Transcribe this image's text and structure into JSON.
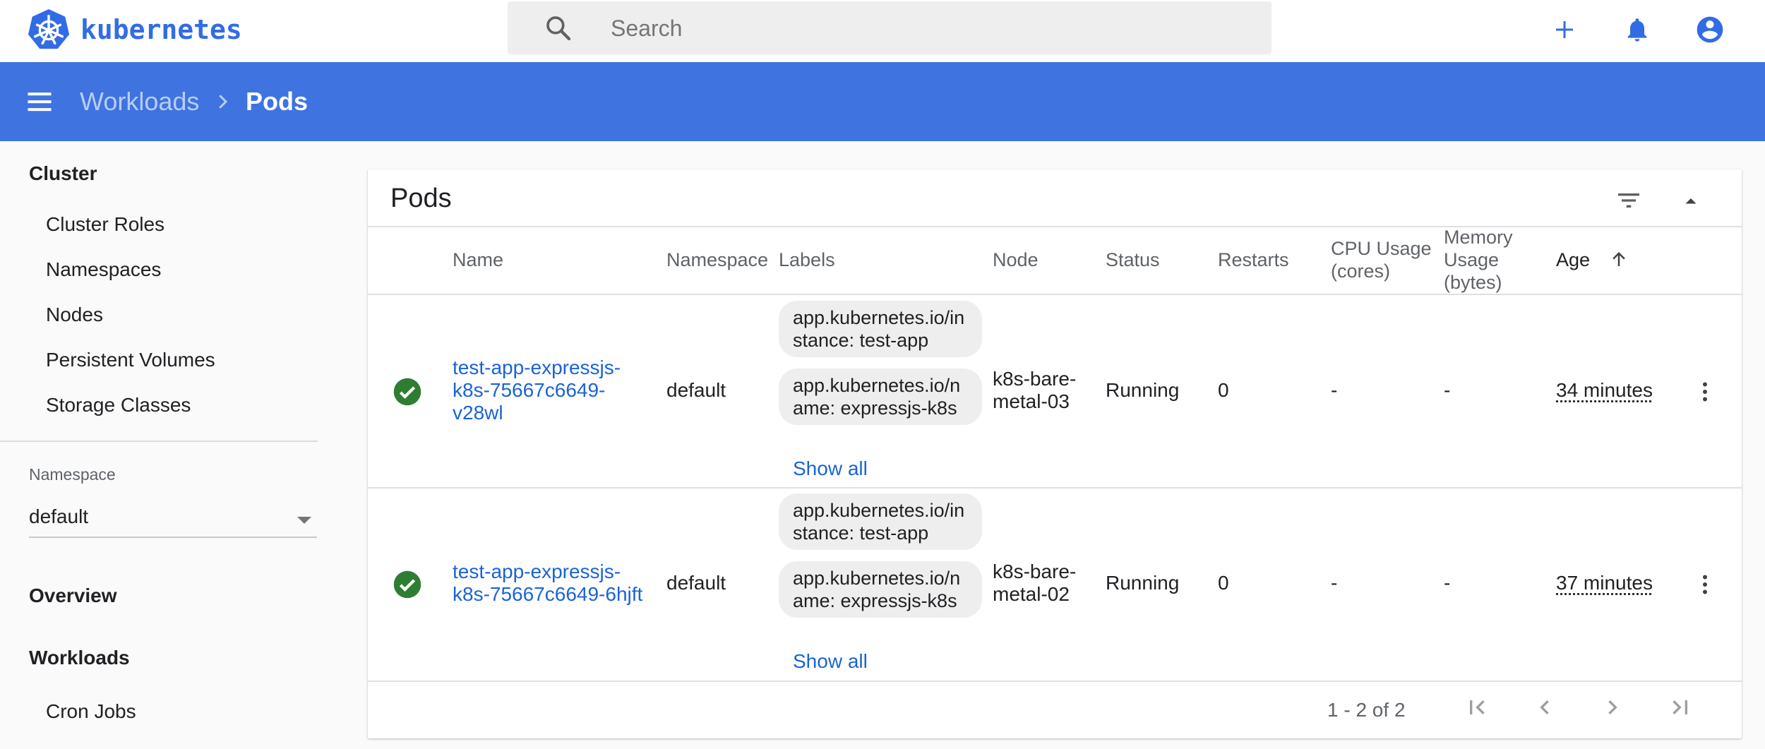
{
  "app": {
    "logo_text": "kubernetes"
  },
  "search": {
    "placeholder": "Search"
  },
  "breadcrumb": {
    "parent": "Workloads",
    "current": "Pods"
  },
  "sidebar": {
    "cluster_heading": "Cluster",
    "cluster_items": [
      {
        "label": "Cluster Roles"
      },
      {
        "label": "Namespaces"
      },
      {
        "label": "Nodes"
      },
      {
        "label": "Persistent Volumes"
      },
      {
        "label": "Storage Classes"
      }
    ],
    "namespace_label": "Namespace",
    "namespace_value": "default",
    "overview": "Overview",
    "workloads": "Workloads",
    "workload_items": [
      {
        "label": "Cron Jobs"
      }
    ]
  },
  "card": {
    "title": "Pods",
    "columns": {
      "name": "Name",
      "namespace": "Namespace",
      "labels": "Labels",
      "node": "Node",
      "status": "Status",
      "restarts": "Restarts",
      "cpu_1": "CPU Usage",
      "cpu_2": "(cores)",
      "mem_1": "Memory",
      "mem_2": "Usage",
      "mem_3": "(bytes)",
      "age": "Age"
    },
    "rows": [
      {
        "name_1": "test-app-expressjs-",
        "name_2": "k8s-75667c6649-",
        "name_3": "v28wl",
        "namespace": "default",
        "label_1": "app.kubernetes.io/instance: test-app",
        "label_2": "app.kubernetes.io/name: expressjs-k8s",
        "show_all": "Show all",
        "node_1": "k8s-bare-",
        "node_2": "metal-03",
        "status": "Running",
        "restarts": "0",
        "cpu": "-",
        "memory": "-",
        "age": "34 minutes"
      },
      {
        "name_1": "test-app-expressjs-",
        "name_2": "k8s-75667c6649-6hjft",
        "name_3": "",
        "namespace": "default",
        "label_1": "app.kubernetes.io/instance: test-app",
        "label_2": "app.kubernetes.io/name: expressjs-k8s",
        "show_all": "Show all",
        "node_1": "k8s-bare-",
        "node_2": "metal-02",
        "status": "Running",
        "restarts": "0",
        "cpu": "-",
        "memory": "-",
        "age": "37 minutes"
      }
    ],
    "paginator": "1 - 2 of 2"
  },
  "colors": {
    "brand": "#326ce5",
    "appbar": "#3f73e0",
    "link": "#1a63d8",
    "status_ok": "#2e7d32"
  },
  "icons": [
    "search-icon",
    "plus-icon",
    "bell-icon",
    "account-icon",
    "menu-icon",
    "chevron-right-icon",
    "filter-icon",
    "collapse-icon",
    "check-circle-icon",
    "more-vert-icon",
    "first-page-icon",
    "prev-page-icon",
    "next-page-icon",
    "last-page-icon",
    "sort-up-icon"
  ]
}
